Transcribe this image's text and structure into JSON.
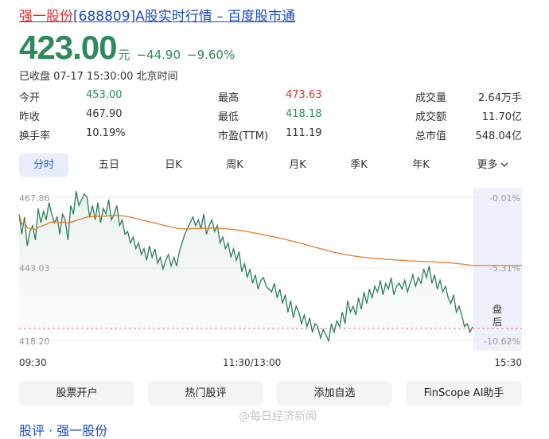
{
  "title": {
    "highlight": "强一股份",
    "rest": "[688809]A股实时行情 – 百度股市通"
  },
  "quote": {
    "price": "423.00",
    "unit": "元",
    "change": "−44.90",
    "change_pct": "−9.60%"
  },
  "status": "已收盘 07-17 15:30:00 北京时间",
  "stats": [
    [
      {
        "label": "今开",
        "value": "453.00",
        "color": "green"
      },
      {
        "label": "最高",
        "value": "473.63",
        "color": "red"
      },
      {
        "label": "成交量",
        "value": "2.64万手",
        "color": "dark"
      }
    ],
    [
      {
        "label": "昨收",
        "value": "467.90",
        "color": "dark"
      },
      {
        "label": "最低",
        "value": "418.18",
        "color": "green"
      },
      {
        "label": "成交额",
        "value": "11.70亿",
        "color": "dark"
      }
    ],
    [
      {
        "label": "换手率",
        "value": "10.19%",
        "color": "dark"
      },
      {
        "label": "市盈(TTM)",
        "value": "111.19",
        "color": "dark"
      },
      {
        "label": "总市值",
        "value": "548.04亿",
        "color": "dark"
      }
    ]
  ],
  "tabs": [
    "分时",
    "五日",
    "日K",
    "周K",
    "月K",
    "季K",
    "年K",
    "更多"
  ],
  "active_tab": "分时",
  "chart": {
    "y_labels": {
      "top": "467.86",
      "mid": "443.03",
      "bottom": "418.20"
    },
    "pct_labels": {
      "top": "-0.01%",
      "mid": "-5.31%",
      "bottom": "-10.62%"
    },
    "x_labels": {
      "start": "09:30",
      "mid": "11:30/13:00",
      "end": "15:30"
    },
    "after_hours": [
      "盘",
      "后"
    ],
    "prev_close": 467.9,
    "y_range": [
      418.2,
      467.86
    ],
    "price_color": "#2e7d5a",
    "avg_color": "#e8792a",
    "prev_close_color": "#e87b7b",
    "price_series": [
      462,
      455,
      461,
      451,
      456,
      458,
      453,
      464,
      459,
      463,
      460,
      466,
      462,
      459,
      461,
      455,
      462,
      460,
      453,
      465,
      462,
      470,
      465,
      467,
      469,
      468,
      461,
      465,
      460,
      466,
      459,
      464,
      462,
      467,
      460,
      462,
      465,
      458,
      460,
      455,
      456,
      452,
      454,
      450,
      452,
      448,
      450,
      446,
      451,
      447,
      450,
      445,
      447,
      443,
      446,
      448,
      444,
      447,
      444,
      449,
      452,
      455,
      457,
      459,
      461,
      458,
      460,
      457,
      462,
      455,
      458,
      460,
      456,
      458,
      452,
      454,
      450,
      452,
      447,
      450,
      446,
      449,
      442,
      445,
      440,
      443,
      438,
      441,
      436,
      439,
      440,
      437,
      436,
      435,
      438,
      433,
      436,
      431,
      434,
      428,
      432,
      426,
      430,
      428,
      424,
      427,
      423,
      426,
      421,
      424,
      423,
      419,
      422,
      420,
      418,
      424,
      421,
      425,
      423,
      428,
      424,
      432,
      428,
      430,
      427,
      433,
      429,
      435,
      431,
      436,
      433,
      437,
      435,
      439,
      434,
      438,
      436,
      440,
      434,
      437,
      438,
      436,
      439,
      435,
      438,
      441,
      437,
      440,
      438,
      443,
      440,
      444,
      438,
      441,
      436,
      439,
      435,
      437,
      433,
      431,
      434,
      428,
      430,
      427,
      423,
      424,
      421,
      423
    ]
  },
  "buttons": [
    "股票开户",
    "热门股评",
    "添加自选",
    "FinScope AI助手"
  ],
  "watermark": "@每日经济新闻",
  "bottom_text": "股评 · 强一股份"
}
